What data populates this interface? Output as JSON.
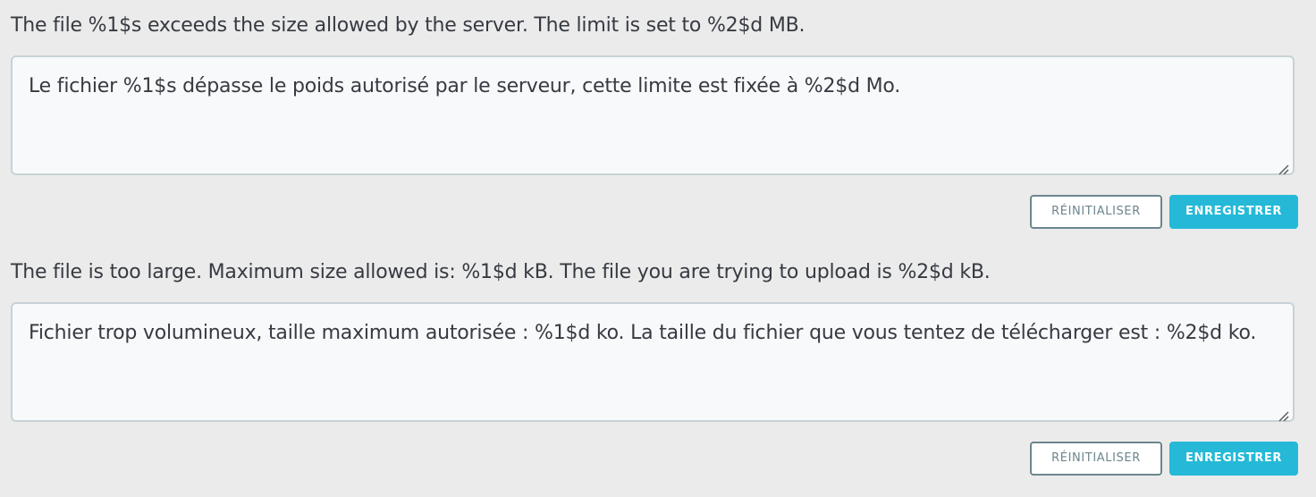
{
  "translations": [
    {
      "source": "The file %1$s exceeds the size allowed by the server. The limit is set to %2$d MB.",
      "translation": "Le fichier %1$s dépasse le poids autorisé par le serveur, cette limite est fixée à %2$d Mo.",
      "reset_label": "RÉINITIALISER",
      "save_label": "ENREGISTRER"
    },
    {
      "source": "The file is too large. Maximum size allowed is: %1$d kB. The file you are trying to upload is %2$d kB.",
      "translation": "Fichier trop volumineux, taille maximum autorisée : %1$d ko. La taille du fichier que vous tentez de télécharger est : %2$d ko.",
      "reset_label": "RÉINITIALISER",
      "save_label": "ENREGISTRER"
    }
  ],
  "colors": {
    "background": "#ebebeb",
    "text": "#363a41",
    "primary_button": "#25b9d7",
    "secondary_button_border": "#6c868e"
  }
}
